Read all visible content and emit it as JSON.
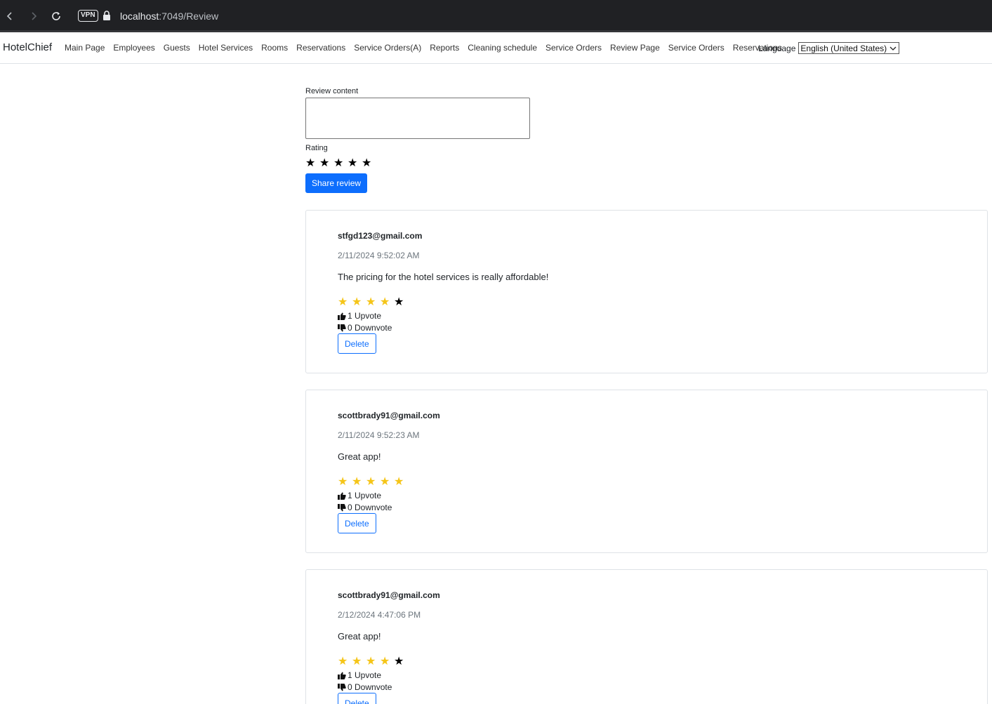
{
  "browser": {
    "vpn_label": "VPN",
    "url_host": "localhost",
    "url_rest": ":7049/Review"
  },
  "navbar": {
    "brand": "HotelChief",
    "items": [
      "Main Page",
      "Employees",
      "Guests",
      "Hotel Services",
      "Rooms",
      "Reservations",
      "Service Orders(A)",
      "Reports",
      "Cleaning schedule",
      "Service Orders",
      "Review Page",
      "Service Orders",
      "Reservations"
    ],
    "language_label": "Language",
    "language_selected": "English (United States)"
  },
  "form": {
    "content_label": "Review content",
    "content_value": "",
    "rating_label": "Rating",
    "rating_stars": 5,
    "submit_label": "Share review"
  },
  "colors": {
    "primary": "#0d6efd",
    "star_gold": "#f5c518"
  },
  "reviews": [
    {
      "user": "stfgd123@gmail.com",
      "date": "2/11/2024 9:52:02 AM",
      "text": "The pricing for the hotel services is really affordable!",
      "rating": 4,
      "upvote": "1 Upvote",
      "downvote": "0 Downvote",
      "delete_label": "Delete"
    },
    {
      "user": "scottbrady91@gmail.com",
      "date": "2/11/2024 9:52:23 AM",
      "text": "Great app!",
      "rating": 5,
      "upvote": "1 Upvote",
      "downvote": "0 Downvote",
      "delete_label": "Delete"
    },
    {
      "user": "scottbrady91@gmail.com",
      "date": "2/12/2024 4:47:06 PM",
      "text": "Great app!",
      "rating": 4,
      "upvote": "1 Upvote",
      "downvote": "0 Downvote",
      "delete_label": "Delete"
    }
  ]
}
